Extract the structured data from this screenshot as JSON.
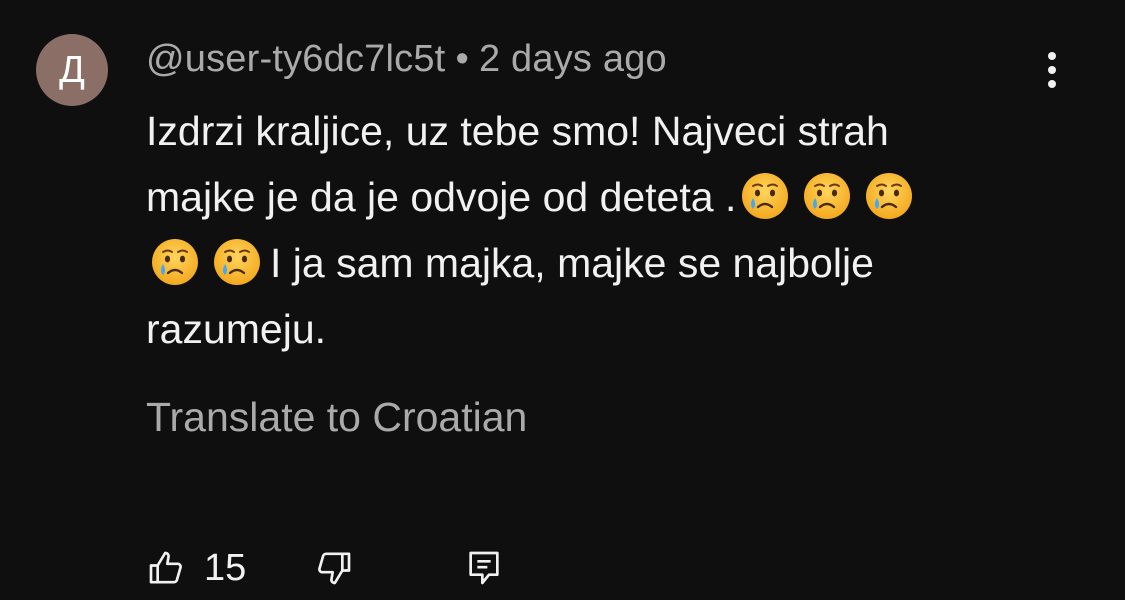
{
  "author": {
    "avatar_letter": "Д",
    "handle": "@user-ty6dc7lc5t",
    "separator": "•",
    "time": "2 days ago"
  },
  "comment": {
    "line1": "Izdrzi kraljice, uz tebe smo! Najveci strah",
    "line2_text": "majke je da je odvoje od deteta .",
    "line3_text": "I ja sam majka, majke se najbolje",
    "line4": "razumeju.",
    "emoji_name": "crying-face-icon"
  },
  "translate_label": "Translate to Croatian",
  "actions": {
    "like_count": "15"
  },
  "colors": {
    "background": "#0f0f0f",
    "primary_text": "#f1f1f1",
    "secondary_text": "#aaaaaa",
    "avatar_bg": "#8b6f67"
  }
}
